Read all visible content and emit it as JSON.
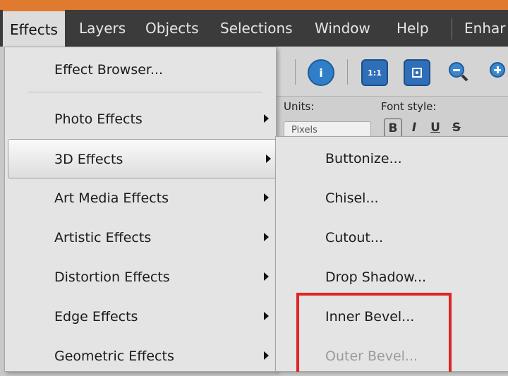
{
  "menubar": {
    "items": [
      {
        "label": "Effects"
      },
      {
        "label": "Layers"
      },
      {
        "label": "Objects"
      },
      {
        "label": "Selections"
      },
      {
        "label": "Window"
      },
      {
        "label": "Help"
      },
      {
        "label": "Enhar"
      }
    ]
  },
  "toolbar": {
    "info_icon": "i",
    "actual_size_icon": "1:1",
    "fit_icon": "fit-window-icon",
    "zoom_out_icon": "magnifier-minus-icon",
    "zoom_in_icon": "magnifier-plus-icon"
  },
  "properties": {
    "units_label": "Units:",
    "units_value": "Pixels",
    "font_style_label": "Font style:",
    "font_style_buttons": [
      "B",
      "I",
      "U",
      "S"
    ]
  },
  "effects_menu": {
    "items": [
      {
        "label": "Effect Browser...",
        "submenu": false
      },
      {
        "label": "Photo Effects",
        "submenu": true
      },
      {
        "label": "3D Effects",
        "submenu": true,
        "highlighted": true
      },
      {
        "label": "Art Media Effects",
        "submenu": true
      },
      {
        "label": "Artistic Effects",
        "submenu": true
      },
      {
        "label": "Distortion Effects",
        "submenu": true
      },
      {
        "label": "Edge Effects",
        "submenu": true
      },
      {
        "label": "Geometric Effects",
        "submenu": true
      }
    ]
  },
  "submenu_3d": {
    "items": [
      {
        "label": "Buttonize...",
        "enabled": true
      },
      {
        "label": "Chisel...",
        "enabled": true
      },
      {
        "label": "Cutout...",
        "enabled": true
      },
      {
        "label": "Drop Shadow...",
        "enabled": true
      },
      {
        "label": "Inner Bevel...",
        "enabled": true
      },
      {
        "label": "Outer Bevel...",
        "enabled": false
      }
    ]
  },
  "colors": {
    "accent": "#e07a2f",
    "annotation": "#e02424",
    "menubar_bg": "#3b3b3b"
  }
}
